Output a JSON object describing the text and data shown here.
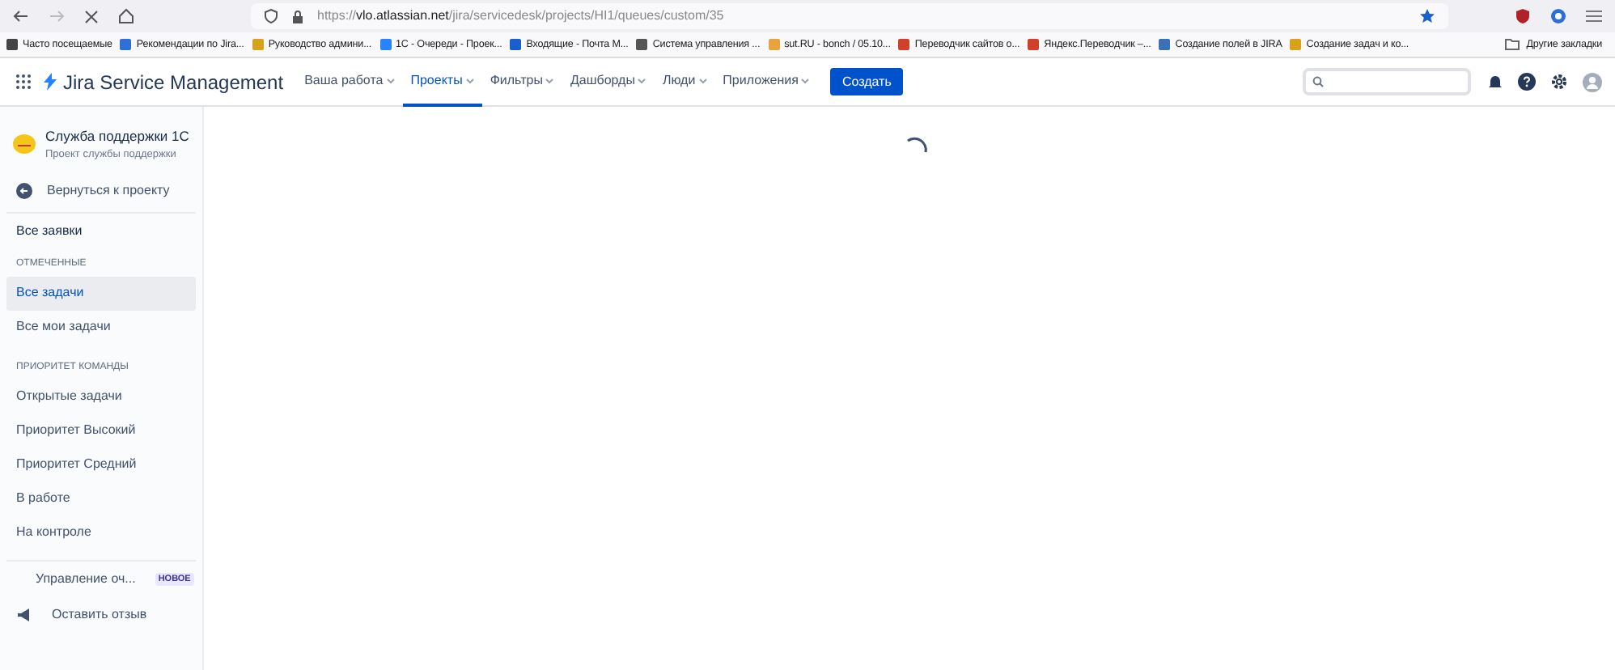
{
  "browser": {
    "url_host": "vlo.atlassian.net",
    "url_path": "/jira/servicedesk/projects/HI1/queues/custom/35",
    "url_scheme": "https://",
    "bookmarks": [
      {
        "label": "Часто посещаемые",
        "color": "#444444"
      },
      {
        "label": "Рекомендации по Jira...",
        "color": "#2f6fd8"
      },
      {
        "label": "Руководство админи...",
        "color": "#d9a21b"
      },
      {
        "label": "1С - Очереди - Проек...",
        "color": "#2684ff"
      },
      {
        "label": "Входящие - Почта М...",
        "color": "#1a5fd0"
      },
      {
        "label": "Система управления ...",
        "color": "#555555"
      },
      {
        "label": "sut.RU - bonch / 05.10...",
        "color": "#e8a33d"
      },
      {
        "label": "Переводчик сайтов о...",
        "color": "#d0402b"
      },
      {
        "label": "Яндекс.Переводчик –...",
        "color": "#d0402b"
      },
      {
        "label": "Создание полей в JIRA",
        "color": "#3b6fb6"
      },
      {
        "label": "Создание задач и ко...",
        "color": "#d9a21b"
      }
    ],
    "other_bookmarks": "Другие закладки"
  },
  "nav": {
    "product": "Jira Service Management",
    "menu": [
      {
        "label": "Ваша работа",
        "selected": false
      },
      {
        "label": "Проекты",
        "selected": true
      },
      {
        "label": "Фильтры",
        "selected": false
      },
      {
        "label": "Дашборды",
        "selected": false
      },
      {
        "label": "Люди",
        "selected": false
      },
      {
        "label": "Приложения",
        "selected": false
      }
    ],
    "create_button": "Создать"
  },
  "sidebar": {
    "project_name": "Служба поддержки 1С",
    "project_subtitle": "Проект службы поддержки",
    "back": "Вернуться к проекту",
    "all_requests": "Все заявки",
    "sections": [
      {
        "heading": "ОТМЕЧЕННЫЕ",
        "items": [
          {
            "label": "Все задачи",
            "selected": true
          },
          {
            "label": "Все мои задачи",
            "selected": false
          }
        ]
      },
      {
        "heading": "ПРИОРИТЕТ КОМАНДЫ",
        "items": [
          {
            "label": "Открытые задачи",
            "selected": false
          },
          {
            "label": "Приоритет Высокий",
            "selected": false
          },
          {
            "label": "Приоритет Средний",
            "selected": false
          },
          {
            "label": "В работе",
            "selected": false
          },
          {
            "label": "На контроле",
            "selected": false
          }
        ]
      }
    ],
    "footer": [
      {
        "kind": "settings",
        "label": "Управление оч...",
        "badge": "НОВОЕ"
      },
      {
        "kind": "feedback",
        "label": "Оставить отзыв"
      }
    ]
  }
}
